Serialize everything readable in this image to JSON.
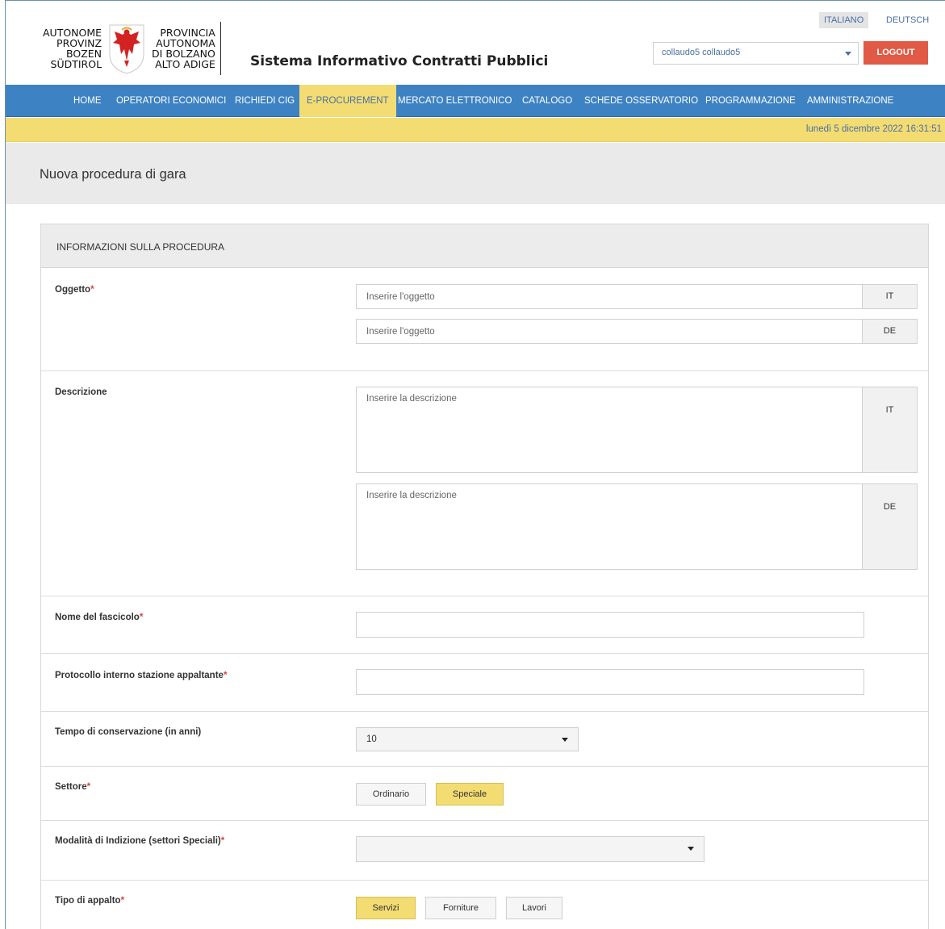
{
  "header": {
    "logo_left": [
      "AUTONOME",
      "PROVINZ",
      "BOZEN",
      "SÜDTIROL"
    ],
    "logo_right": [
      "PROVINCIA",
      "AUTONOMA",
      "DI BOLZANO",
      "ALTO ADIGE"
    ],
    "app_title": "Sistema Informativo Contratti Pubblici",
    "languages": [
      "ITALIANO",
      "DEUTSCH"
    ],
    "active_language": "ITALIANO",
    "user": "collaudo5 collaudo5",
    "logout_label": "LOGOUT"
  },
  "nav": {
    "items": [
      "HOME",
      "OPERATORI ECONOMICI",
      "RICHIEDI CIG",
      "E-PROCUREMENT",
      "MERCATO ELETTRONICO",
      "CATALOGO",
      "SCHEDE OSSERVATORIO",
      "PROGRAMMAZIONE",
      "AMMINISTRAZIONE"
    ],
    "active": "E-PROCUREMENT"
  },
  "datetime": "lunedì 5 dicembre 2022 16:31:51",
  "page_title": "Nuova procedura di gara",
  "panel": {
    "title": "INFORMAZIONI SULLA PROCEDURA",
    "required_mark": "*",
    "oggetto": {
      "label": "Oggetto",
      "it_placeholder": "Inserire l'oggetto",
      "it_addon": "IT",
      "de_placeholder": "Inserire l'oggetto",
      "de_addon": "DE"
    },
    "descrizione": {
      "label": "Descrizione",
      "it_placeholder": "Inserire la descrizione",
      "it_addon": "IT",
      "de_placeholder": "Inserire la descrizione",
      "de_addon": "DE"
    },
    "fascicolo": {
      "label": "Nome del fascicolo",
      "value": ""
    },
    "protocollo": {
      "label": "Protocollo interno stazione appaltante",
      "value": ""
    },
    "conservazione": {
      "label": "Tempo di conservazione (in anni)",
      "value": "10"
    },
    "settore": {
      "label": "Settore",
      "options": [
        "Ordinario",
        "Speciale"
      ],
      "selected": "Speciale"
    },
    "modalita": {
      "label": "Modalità di Indizione (settori Speciali)",
      "value": ""
    },
    "tipo_appalto": {
      "label": "Tipo di appalto",
      "options": [
        "Servizi",
        "Forniture",
        "Lavori"
      ],
      "selected": "Servizi"
    }
  },
  "colors": {
    "nav_blue": "#3d82c3",
    "accent_yellow": "#f3dc72",
    "logout_red": "#e05a46",
    "link_blue": "#4a6fa5"
  }
}
